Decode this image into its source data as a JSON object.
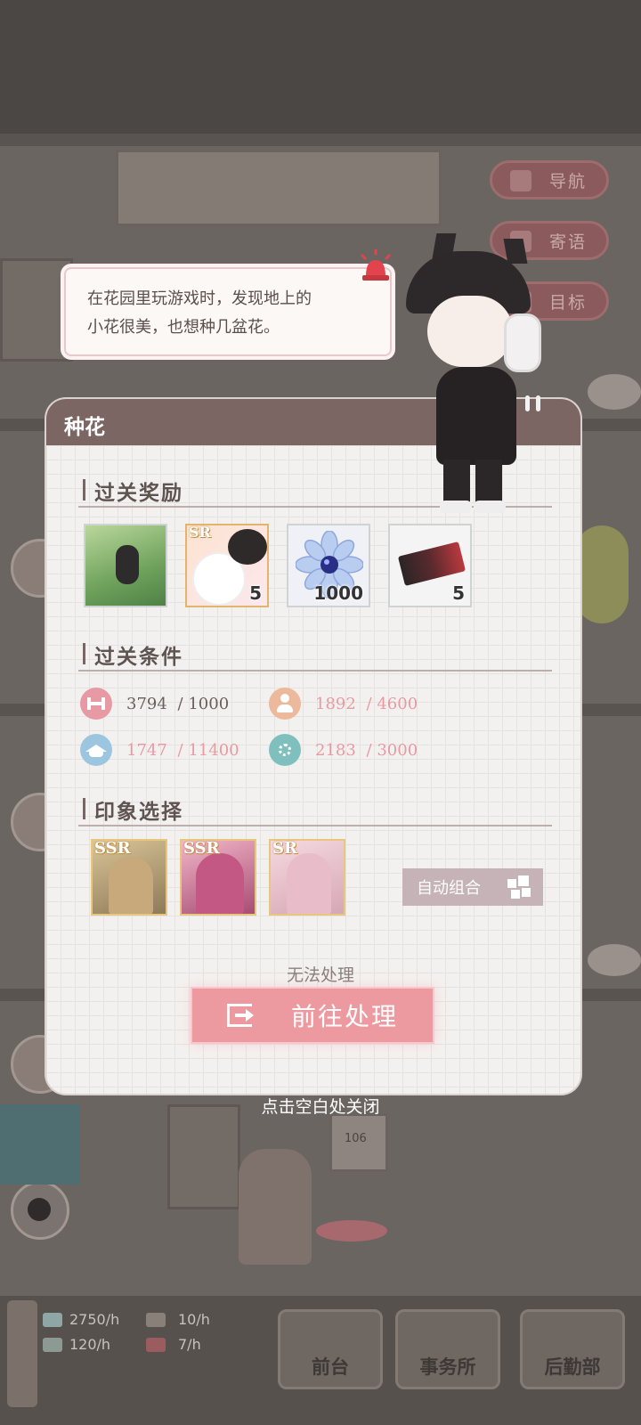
{
  "nav": {
    "navigate": "导航",
    "messages": "寄语",
    "goals": "目标"
  },
  "speech": {
    "line1": "在花园里玩游戏时，发现地上的",
    "line2": "小花很美，也想种几盆花。"
  },
  "panel": {
    "title": "种花",
    "rewards_title": "过关奖励",
    "rewards": [
      {
        "name": "card-illustration",
        "count": ""
      },
      {
        "name": "sr-cats-card",
        "badge": "SR",
        "count": "5"
      },
      {
        "name": "crystal-flower",
        "count": "1000"
      },
      {
        "name": "ticket",
        "count": "5"
      }
    ],
    "conditions_title": "过关条件",
    "conditions": [
      {
        "icon": "dumbbell-icon",
        "current": "3794",
        "required": "/ 1000",
        "color": "#e799a4"
      },
      {
        "icon": "person-icon",
        "current": "1892",
        "required": "/ 4600",
        "color": "#ecb99c"
      },
      {
        "icon": "graduation-cap-icon",
        "current": "1747",
        "required": "/ 11400",
        "color": "#9cc6df"
      },
      {
        "icon": "flower-icon",
        "current": "2183",
        "required": "/ 3000",
        "color": "#7fc0bf"
      }
    ],
    "impression_title": "印象选择",
    "cards": [
      {
        "rank": "SSR"
      },
      {
        "rank": "SSR"
      },
      {
        "rank": "SR"
      }
    ],
    "auto_combo": "自动组合",
    "cannot_process": "无法处理",
    "go_process": "前往处理"
  },
  "close_hint": "点击空白处关闭",
  "room_number": "106",
  "resources": [
    {
      "value": "2750/h"
    },
    {
      "value": "10/h"
    },
    {
      "value": "120/h"
    },
    {
      "value": "7/h"
    }
  ],
  "bottom_tabs": {
    "front_desk": "前台",
    "office": "事务所",
    "logistics": "后勤部"
  },
  "colors": {
    "accent_pink": "#ec9aa0",
    "header_brown": "#7b6664",
    "ok_text": "#6a5f5c",
    "warn_text": "#e89aa3"
  }
}
